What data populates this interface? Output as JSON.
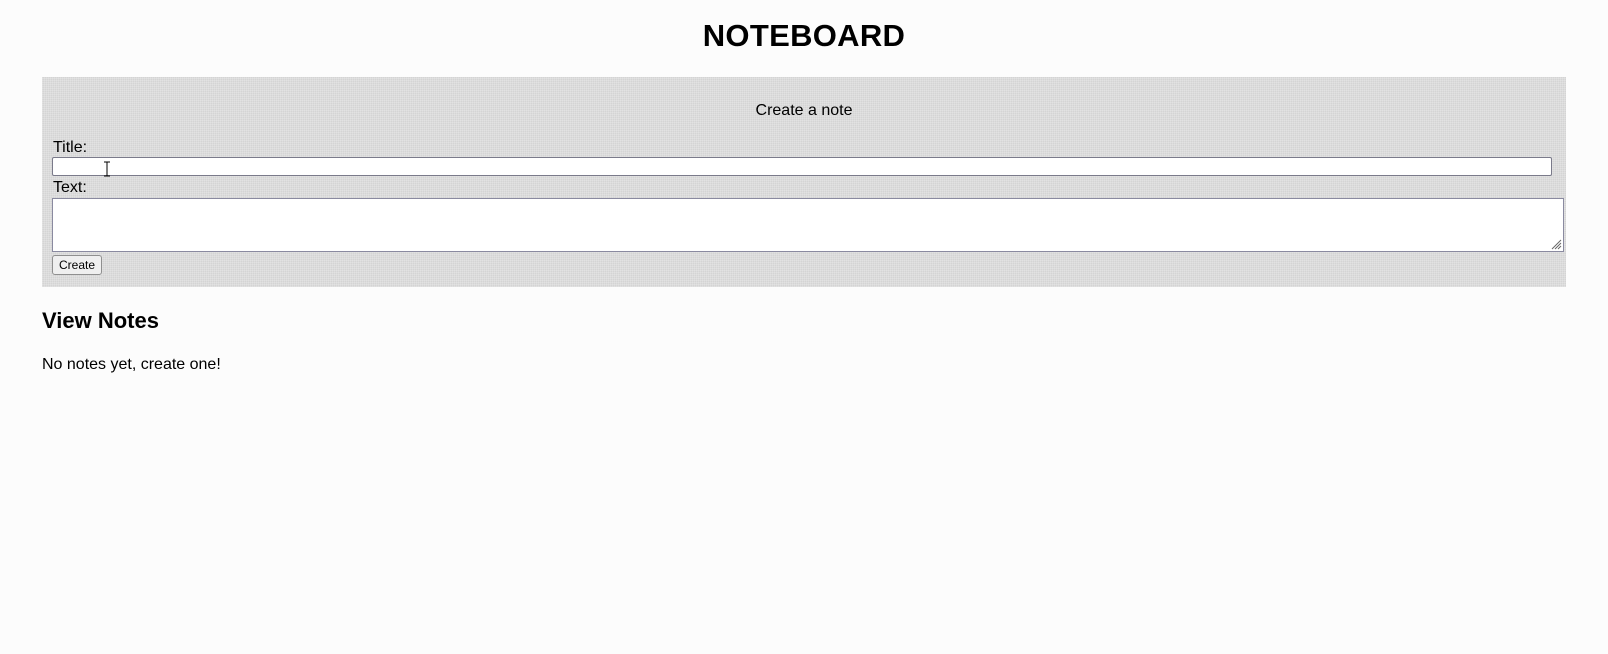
{
  "header": {
    "title": "NOTEBOARD"
  },
  "create_form": {
    "heading": "Create a note",
    "title_label": "Title:",
    "title_value": "",
    "text_label": "Text:",
    "text_value": "",
    "submit_label": "Create",
    "panel_color": "#d4d4d4"
  },
  "notes_section": {
    "heading": "View Notes",
    "empty_message": "No notes yet, create one!",
    "notes": []
  }
}
